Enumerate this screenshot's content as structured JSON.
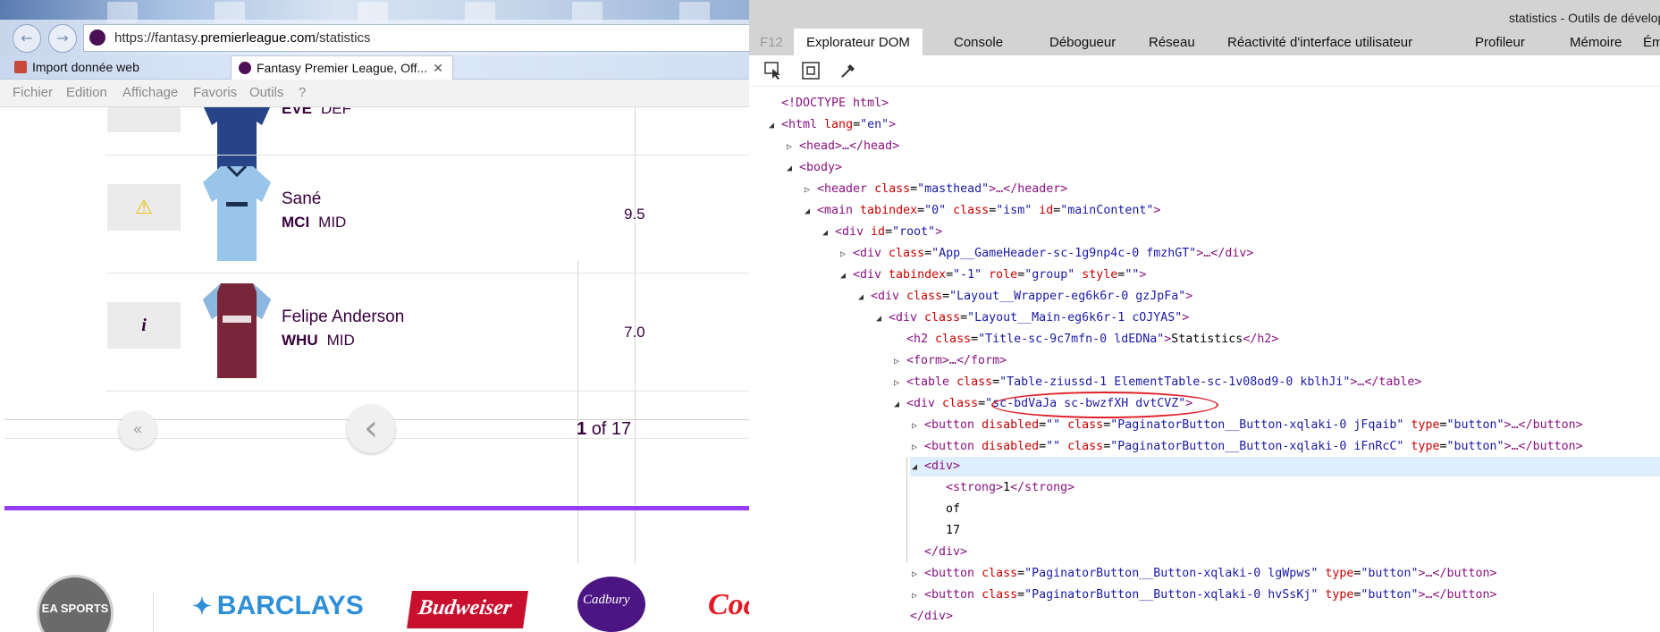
{
  "browser": {
    "nav_back": "←",
    "nav_forward": "→",
    "url_prefix": "https://fantasy.",
    "url_domain": "premierleague.com",
    "url_path": "/statistics",
    "tabs": [
      {
        "label": "Import donnée web"
      },
      {
        "label": "Fantasy Premier League, Off...",
        "close": "✕"
      }
    ],
    "menu": [
      "Fichier",
      "Edition",
      "Affichage",
      "Favoris",
      "Outils",
      "?"
    ]
  },
  "page": {
    "players": [
      {
        "name": "",
        "team": "EVE",
        "pos": "DEF",
        "value": "",
        "icon": "",
        "shirt_color": "#274488"
      },
      {
        "name": "Sané",
        "team": "MCI",
        "pos": "MID",
        "value": "9.5",
        "icon": "⚠",
        "shirt_color": "#98c5e9"
      },
      {
        "name": "Felipe Anderson",
        "team": "WHU",
        "pos": "MID",
        "value": "7.0",
        "icon": "i",
        "shirt_color": "#7a263a"
      }
    ],
    "pagination": {
      "first": "«",
      "prev": "‹",
      "current": "1",
      "of": "of 17"
    },
    "sponsors": {
      "ea": "EA SPORTS",
      "barclays": "BARCLAYS",
      "budweiser": "Budweiser",
      "cadbury": "Cadbury",
      "coca": "Coca"
    },
    "colors": {
      "brand": "#37003c",
      "accent": "#963cff"
    }
  },
  "devtools": {
    "title": "statistics - Outils de dévelop",
    "f12": "F12",
    "tabs": [
      "Explorateur DOM",
      "Console",
      "Débogueur",
      "Réseau",
      "Réactivité d'interface utilisateur",
      "Profileur",
      "Mémoire",
      "Ému"
    ],
    "lines": {
      "doctype": "<!DOCTYPE html>",
      "html_tag": "<html",
      "html_lang_attr": "lang",
      "html_lang_val": "\"en\"",
      "head": "<head>…</head>",
      "body": "<body>",
      "header_open": "<header",
      "header_class_val": "\"masthead\"",
      "header_close": ">…</header>",
      "main_open": "<main",
      "main_tabindex_val": "\"0\"",
      "main_class_val": "\"ism\"",
      "main_id_val": "\"mainContent\"",
      "div_root_id": "\"root\"",
      "gameheader_val": "\"App__GameHeader-sc-1g9np4c-0 fmzhGT\"",
      "tabindex_val": "\"-1\"",
      "role_val": "\"group\"",
      "style_val": "\"\"",
      "wrapper_val": "\"Layout__Wrapper-eg6k6r-0 gzJpFa\"",
      "main_val": "\"Layout__Main-eg6k6r-1 cOJYAS\"",
      "h2_val": "\"Title-sc-9c7mfn-0 ldEDNa\"",
      "h2_text": "Statistics",
      "form": "<form>…</form>",
      "table_val": "\"Table-ziussd-1 ElementTable-sc-1v08od9-0 kblhJi\"",
      "table_close": ">…</table>",
      "pager_val": "\"sc-bdVaJa sc-bwzfXH dvtCVZ\"",
      "btn1_val": "\"PaginatorButton__Button-xqlaki-0 jFqaib\"",
      "btn2_val": "\"PaginatorButton__Button-xqlaki-0 iFnRcC\"",
      "btn3_val": "\"PaginatorButton__Button-xqlaki-0 lgWpws\"",
      "btn4_val": "\"PaginatorButton__Button-xqlaki-0 hvSsKj\"",
      "type_val": "\"button\"",
      "disabled_val": "\"\"",
      "strong_text": "1",
      "of_text": "of",
      "n17_text": "17"
    }
  }
}
